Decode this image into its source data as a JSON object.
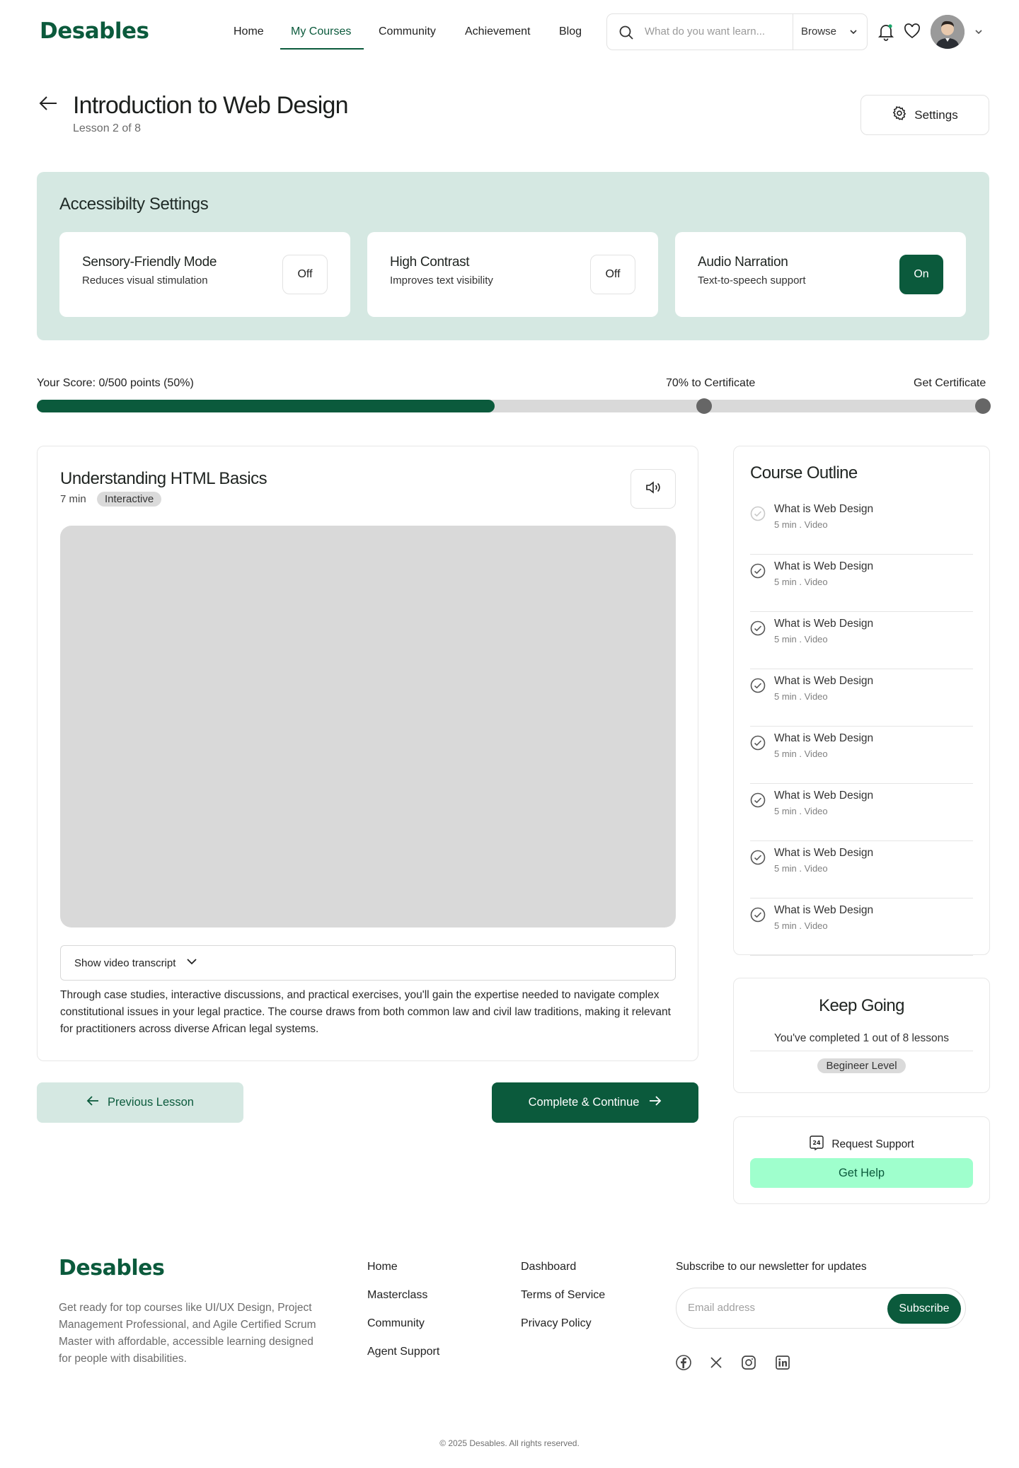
{
  "brand": {
    "name": "Desables",
    "color": "#0b5a3c"
  },
  "nav": {
    "links": [
      "Home",
      "My Courses",
      "Community",
      "Achievement",
      "Blog"
    ],
    "active": "My Courses"
  },
  "search": {
    "placeholder": "What do you want learn...",
    "browse_label": "Browse"
  },
  "header_icons": [
    "bell-icon",
    "heart-icon",
    "avatar",
    "chevron-down-icon"
  ],
  "page": {
    "title": "Introduction to Web Design",
    "subtitle": "Lesson 2 of 8",
    "settings_label": "Settings"
  },
  "accessibility": {
    "title": "Accessibilty Settings",
    "cards": [
      {
        "title": "Sensory-Friendly Mode",
        "desc": "Reduces visual stimulation",
        "state": "Off"
      },
      {
        "title": "High Contrast",
        "desc": "Improves text visibility",
        "state": "Off"
      },
      {
        "title": "Audio Narration",
        "desc": "Text-to-speech support",
        "state": "On"
      }
    ]
  },
  "progress": {
    "score_label": "Your Score: 0/500 points (50%)",
    "milestone_label": "70% to Certificate",
    "end_label": "Get Certificate",
    "percent": 50,
    "milestone_percent": 70
  },
  "lesson": {
    "title": "Understanding HTML Basics",
    "duration": "7 min",
    "tag": "Interactive",
    "transcript_label": "Show video transcript",
    "description": "Through case studies, interactive discussions, and practical exercises, you'll gain the expertise needed to navigate complex constitutional issues in your legal practice. The course draws from both common law and civil law traditions, making it relevant for practitioners across diverse African legal systems."
  },
  "nav_buttons": {
    "prev": "Previous Lesson",
    "next": "Complete & Continue"
  },
  "outline": {
    "title": "Course Outline",
    "items": [
      {
        "title": "What is Web Design",
        "meta": "5 min . Video",
        "done": false
      },
      {
        "title": "What is Web Design",
        "meta": "5 min . Video",
        "done": true
      },
      {
        "title": "What is Web Design",
        "meta": "5 min . Video",
        "done": true
      },
      {
        "title": "What is Web Design",
        "meta": "5 min . Video",
        "done": true
      },
      {
        "title": "What is Web Design",
        "meta": "5 min . Video",
        "done": true
      },
      {
        "title": "What is Web Design",
        "meta": "5 min . Video",
        "done": true
      },
      {
        "title": "What is Web Design",
        "meta": "5 min . Video",
        "done": true
      },
      {
        "title": "What is Web Design",
        "meta": "5 min . Video",
        "done": true
      }
    ]
  },
  "keep_going": {
    "title": "Keep Going",
    "text": "You've completed 1 out of 8 lessons",
    "level": "Begineer Level"
  },
  "support": {
    "title": "Request Support",
    "button": "Get Help"
  },
  "footer": {
    "brand": "Desables",
    "description": "Get ready for top courses like UI/UX Design, Project Management Professional, and Agile Certified Scrum Master with affordable, accessible learning designed for people with disabilities.",
    "col1": [
      "Home",
      "Masterclass",
      "Community",
      "Agent Support"
    ],
    "col2": [
      "Dashboard",
      "Terms of Service",
      "Privacy Policy"
    ],
    "newsletter_heading": "Subscribe to our newsletter for updates",
    "email_placeholder": "Email address",
    "subscribe_label": "Subscribe",
    "socials": [
      "facebook-icon",
      "x-icon",
      "instagram-icon",
      "linkedin-icon"
    ],
    "copyright": "© 2025 Desables. All rights reserved."
  }
}
